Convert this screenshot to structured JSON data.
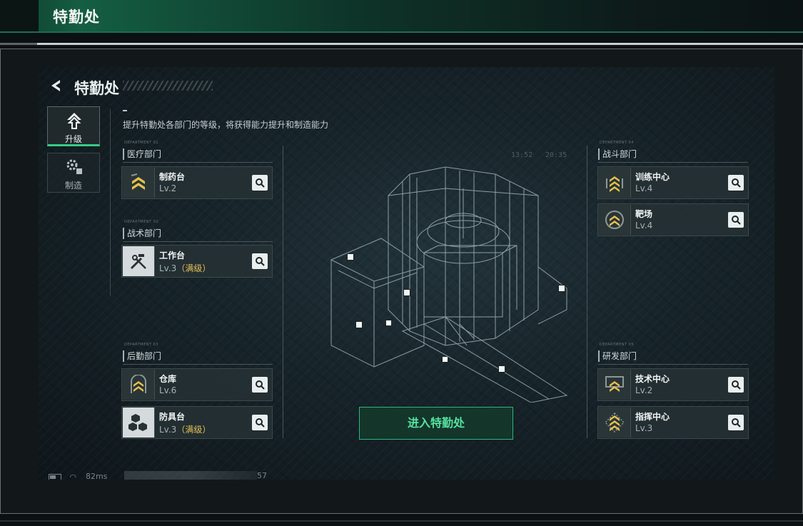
{
  "outer": {
    "title": "特勤处"
  },
  "screen": {
    "title": "特勤处",
    "description": "提升特勤处各部门的等级，将获得能力提升和制造能力",
    "tabs": [
      {
        "label": "升级",
        "icon": "upgrade-icon",
        "active": true
      },
      {
        "label": "制造",
        "icon": "gears-icon",
        "active": false
      }
    ],
    "sections": {
      "medical": {
        "label": "医疗部门",
        "micro": "DEPARTMENT 01"
      },
      "tactical": {
        "label": "战术部门",
        "micro": "DEPARTMENT 02"
      },
      "logistics": {
        "label": "后勤部门",
        "micro": "DEPARTMENT 03"
      },
      "combat": {
        "label": "战斗部门",
        "micro": "DEPARTMENT 04"
      },
      "research": {
        "label": "研发部门",
        "micro": "DEPARTMENT 05"
      }
    },
    "buildings": {
      "pharmacy": {
        "name": "制药台",
        "level": "Lv.2",
        "maxed": ""
      },
      "workbench": {
        "name": "工作台",
        "level": "Lv.3",
        "maxed": "（满级）"
      },
      "warehouse": {
        "name": "仓库",
        "level": "Lv.6",
        "maxed": ""
      },
      "armor": {
        "name": "防具台",
        "level": "Lv.3",
        "maxed": "（满级）"
      },
      "training": {
        "name": "训练中心",
        "level": "Lv.4",
        "maxed": ""
      },
      "range": {
        "name": "靶场",
        "level": "Lv.4",
        "maxed": ""
      },
      "tech": {
        "name": "技术中心",
        "level": "Lv.2",
        "maxed": ""
      },
      "command": {
        "name": "指挥中心",
        "level": "Lv.3",
        "maxed": ""
      }
    },
    "enter_button": "进入特勤处",
    "hud_time_left": "13:52",
    "hud_time_right": "20:35",
    "status": {
      "ping": "82ms",
      "chat_count": "57"
    }
  },
  "colors": {
    "accent_green": "#37c98a",
    "maxed_gold": "#e3bf56",
    "header_green": "#145e43"
  }
}
